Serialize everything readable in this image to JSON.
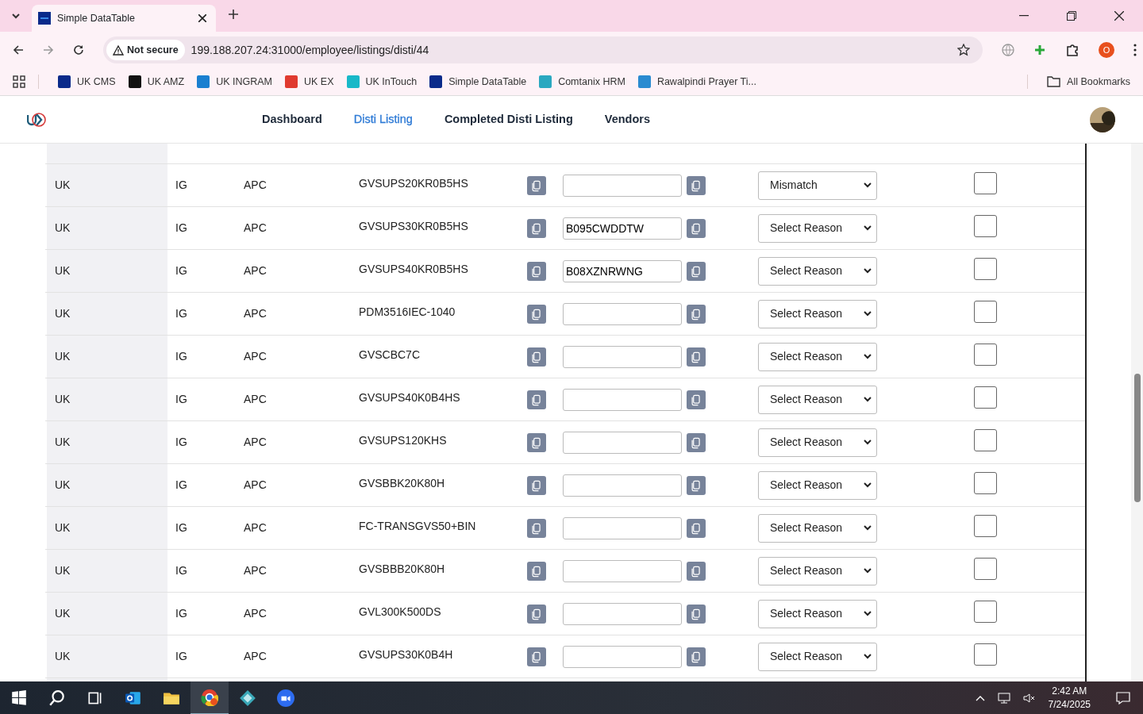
{
  "browser": {
    "tabs": [
      {
        "title": "Simple DataTable",
        "selected": true
      }
    ],
    "address": {
      "security": "Not secure",
      "url": "199.188.207.24:31000/employee/listings/disti/44"
    },
    "bookmarks": [
      {
        "label": "UK CMS",
        "color": "#0a2a8a"
      },
      {
        "label": "UK AMZ",
        "color": "#111111"
      },
      {
        "label": "UK INGRAM",
        "color": "#1a7fd0"
      },
      {
        "label": "UK EX",
        "color": "#e03a2f"
      },
      {
        "label": "UK InTouch",
        "color": "#18b8c8"
      },
      {
        "label": "Simple DataTable",
        "color": "#0a2a8a"
      },
      {
        "label": "Comtanix HRM",
        "color": "#2aa8c0"
      },
      {
        "label": "Rawalpindi Prayer Ti...",
        "color": "#2a8ad0"
      }
    ],
    "all_bookmarks": "All Bookmarks",
    "profile_initial": "O"
  },
  "nav": {
    "items": [
      {
        "label": "Dashboard",
        "selected": false
      },
      {
        "label": "Disti Listing",
        "selected": true
      },
      {
        "label": "Completed Disti Listing",
        "selected": false
      },
      {
        "label": "Vendors",
        "selected": false
      }
    ]
  },
  "rows": [
    {
      "country": "UK",
      "disti": "IG",
      "brand": "APC",
      "sku": "GVSUPS20KR0B5HS",
      "asin": "",
      "reason": "Mismatch",
      "checked": false
    },
    {
      "country": "UK",
      "disti": "IG",
      "brand": "APC",
      "sku": "GVSUPS30KR0B5HS",
      "asin": "B095CWDDTW",
      "reason": "Select Reason",
      "checked": false
    },
    {
      "country": "UK",
      "disti": "IG",
      "brand": "APC",
      "sku": "GVSUPS40KR0B5HS",
      "asin": "B08XZNRWNG",
      "reason": "Select Reason",
      "checked": false
    },
    {
      "country": "UK",
      "disti": "IG",
      "brand": "APC",
      "sku": "PDM3516IEC-1040",
      "asin": "",
      "reason": "Select Reason",
      "checked": false
    },
    {
      "country": "UK",
      "disti": "IG",
      "brand": "APC",
      "sku": "GVSCBC7C",
      "asin": "",
      "reason": "Select Reason",
      "checked": false
    },
    {
      "country": "UK",
      "disti": "IG",
      "brand": "APC",
      "sku": "GVSUPS40K0B4HS",
      "asin": "",
      "reason": "Select Reason",
      "checked": false
    },
    {
      "country": "UK",
      "disti": "IG",
      "brand": "APC",
      "sku": "GVSUPS120KHS",
      "asin": "",
      "reason": "Select Reason",
      "checked": false
    },
    {
      "country": "UK",
      "disti": "IG",
      "brand": "APC",
      "sku": "GVSBBK20K80H",
      "asin": "",
      "reason": "Select Reason",
      "checked": false
    },
    {
      "country": "UK",
      "disti": "IG",
      "brand": "APC",
      "sku": "FC-TRANSGVS50+BIN",
      "asin": "",
      "reason": "Select Reason",
      "checked": false
    },
    {
      "country": "UK",
      "disti": "IG",
      "brand": "APC",
      "sku": "GVSBBB20K80H",
      "asin": "",
      "reason": "Select Reason",
      "checked": false
    },
    {
      "country": "UK",
      "disti": "IG",
      "brand": "APC",
      "sku": "GVL300K500DS",
      "asin": "",
      "reason": "Select Reason",
      "checked": false
    },
    {
      "country": "UK",
      "disti": "IG",
      "brand": "APC",
      "sku": "GVSUPS30K0B4H",
      "asin": "",
      "reason": "Select Reason",
      "checked": false
    }
  ],
  "taskbar": {
    "time": "2:42 AM",
    "date": "7/24/2025"
  }
}
